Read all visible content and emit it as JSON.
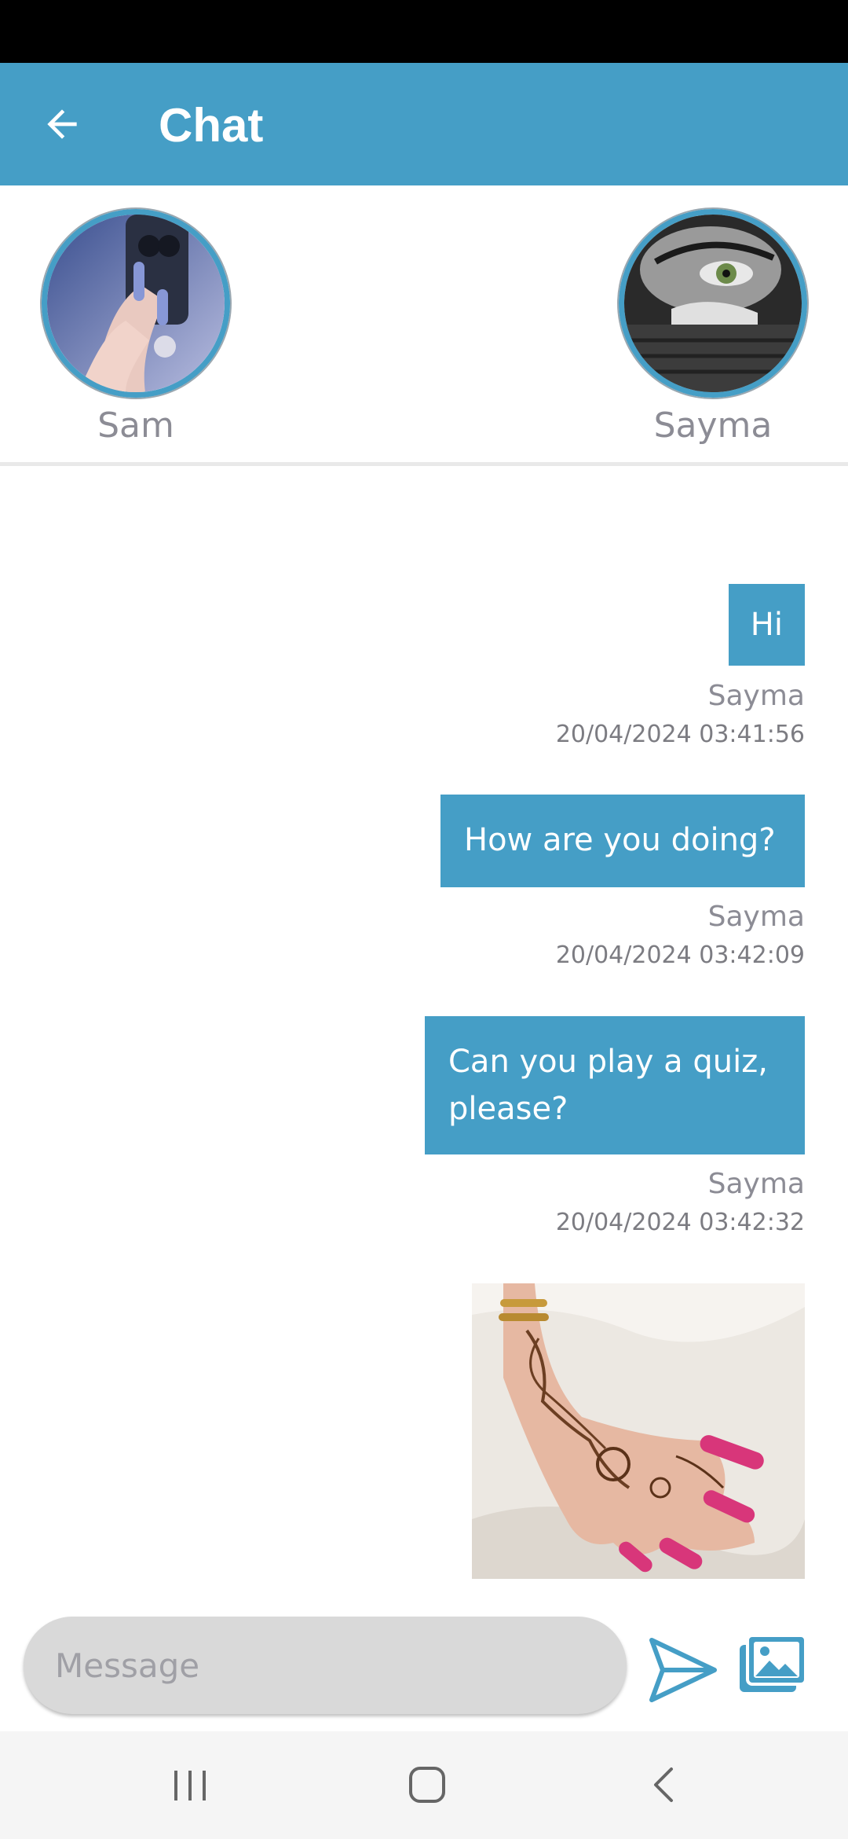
{
  "app": {
    "title": "Chat"
  },
  "colors": {
    "accent": "#459ec6",
    "status_bar": "#000000",
    "input_bg": "#d9d9d9"
  },
  "participants": [
    {
      "name": "Sam"
    },
    {
      "name": "Sayma"
    }
  ],
  "messages": [
    {
      "text": "Hi",
      "sender": "Sayma",
      "timestamp": "20/04/2024 03:41:56"
    },
    {
      "text": "How are you doing?",
      "sender": "Sayma",
      "timestamp": "20/04/2024 03:42:09"
    },
    {
      "text": "Can you play a quiz, please?",
      "sender": "Sayma",
      "timestamp": "20/04/2024 03:42:32"
    },
    {
      "type": "image"
    }
  ],
  "composer": {
    "placeholder": "Message",
    "value": ""
  },
  "icons": {
    "back": "arrow-left-icon",
    "send": "send-icon",
    "image": "image-gallery-icon",
    "recents": "recents-icon",
    "home": "home-icon",
    "nav_back": "chevron-left-icon"
  }
}
